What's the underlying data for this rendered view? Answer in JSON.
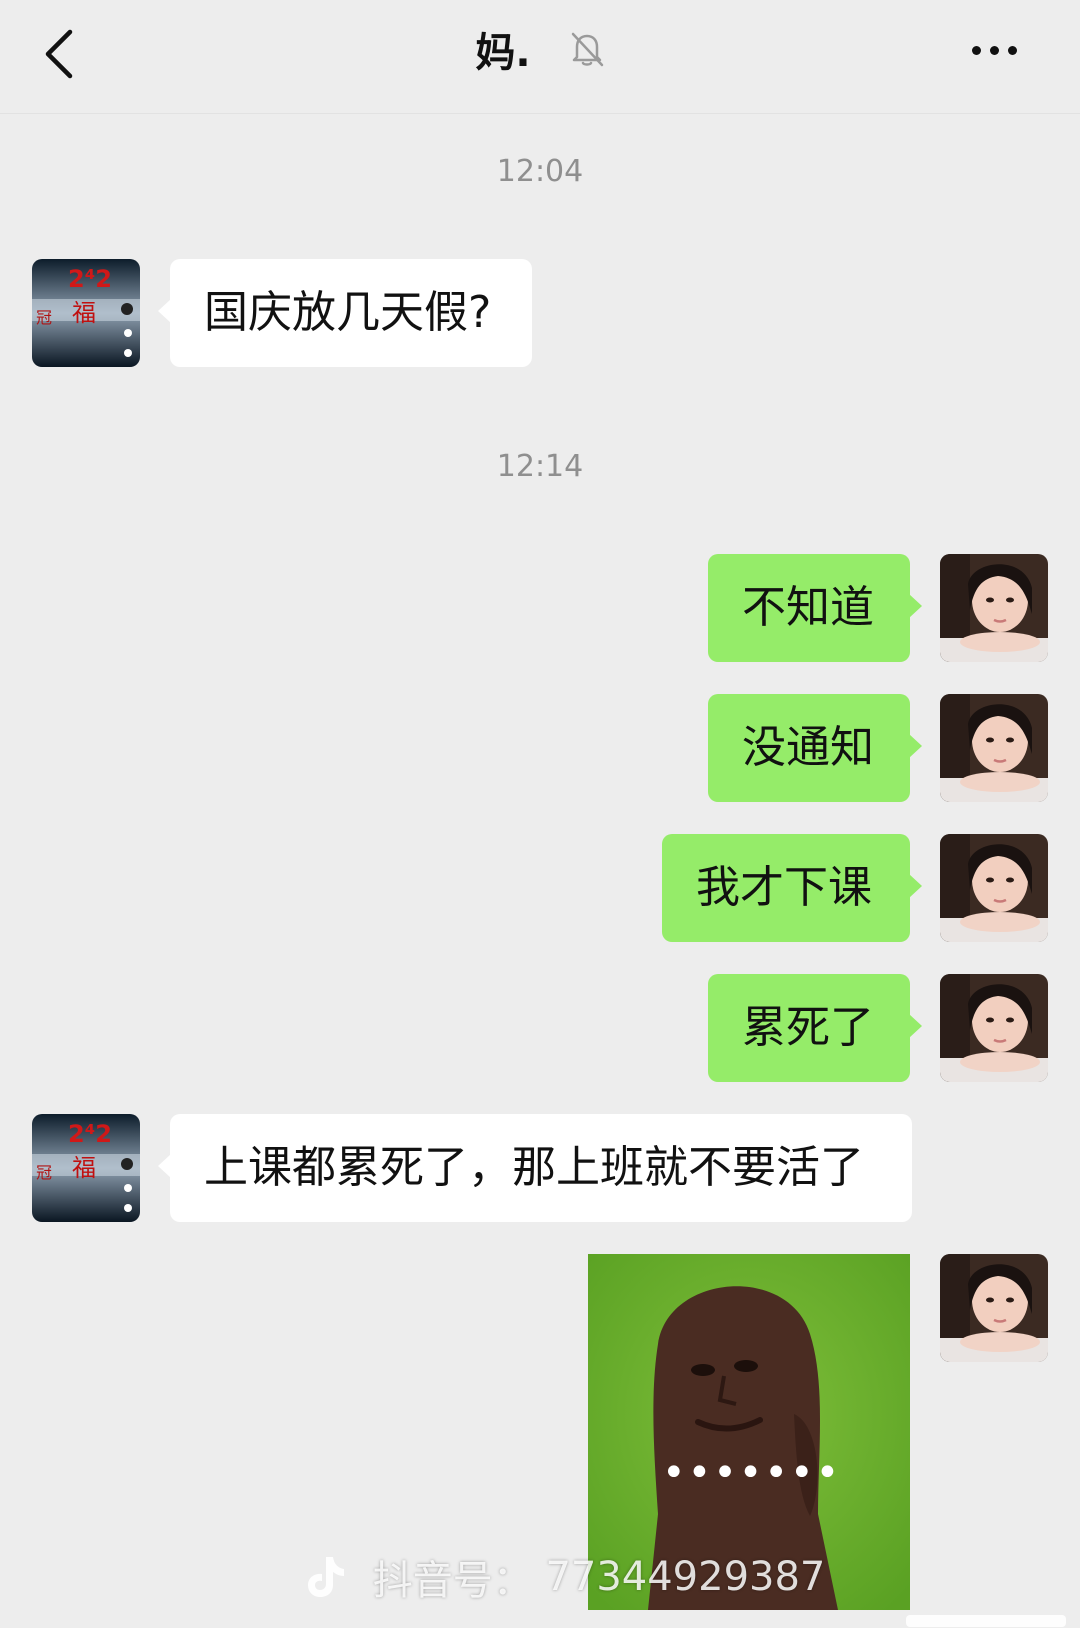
{
  "header": {
    "title": "妈.",
    "back_icon": "chevron-left-icon",
    "mute_icon": "bell-off-icon",
    "more_icon": "more-horizontal-icon"
  },
  "messages": {
    "time_1": "12:04",
    "incoming_1": "国庆放几天假?",
    "time_2": "12:14",
    "outgoing_1": "不知道",
    "outgoing_2": "没通知",
    "outgoing_3": "我才下课",
    "outgoing_4": "累死了",
    "incoming_2": "上课都累死了，那上班就不要活了",
    "sticker_text": "•••••••"
  },
  "watermark": {
    "label": "抖音号：",
    "id": "77344929387"
  },
  "colors": {
    "background": "#ededed",
    "outgoing_bubble": "#95ec69",
    "incoming_bubble": "#ffffff",
    "timestamp": "#8f8f8f"
  }
}
